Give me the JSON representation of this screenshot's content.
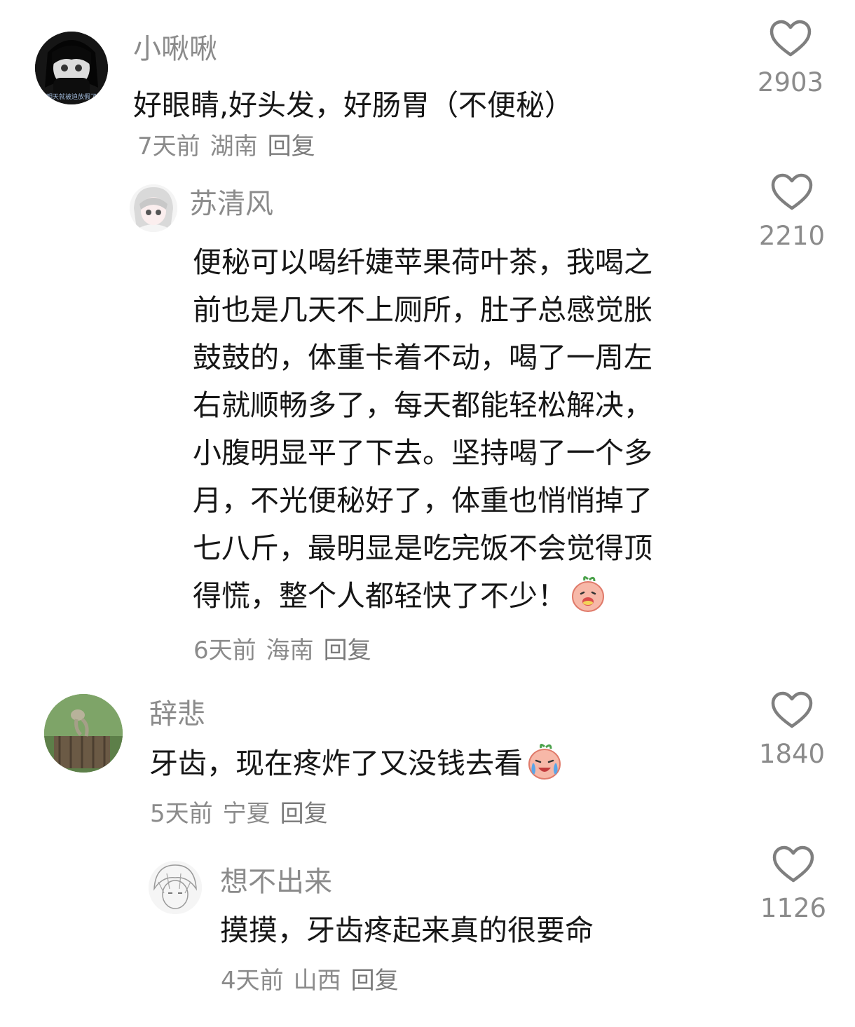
{
  "comments": [
    {
      "username": "小啾啾",
      "text": "好眼睛,好头发，好肠胃（不便秘）",
      "time": "7天前",
      "location": "湖南",
      "reply": "回复",
      "likes": "2903",
      "avatar_text": "我想明天就被迫放假了都给"
    },
    {
      "username": "苏清风",
      "text_lines": [
        "便秘可以喝纤婕苹果荷叶茶，我喝之",
        "前也是几天不上厕所，肚子总感觉胀",
        "鼓鼓的，体重卡着不动，喝了一周左",
        "右就顺畅多了，每天都能轻松解决，",
        "小腹明显平了下去。坚持喝了一个多",
        "月，不光便秘好了，体重也悄悄掉了",
        "七八斤，最明显是吃完饭不会觉得顶",
        "得慌，整个人都轻快了不少！"
      ],
      "time": "6天前",
      "location": "海南",
      "reply": "回复",
      "likes": "2210",
      "emoji": "happy-peach-emoji"
    },
    {
      "username": "辞悲",
      "text": "牙齿，现在疼炸了又没钱去看",
      "time": "5天前",
      "location": "宁夏",
      "reply": "回复",
      "likes": "1840",
      "emoji": "crying-peach-emoji"
    },
    {
      "username": "想不出来",
      "text": "摸摸，牙齿疼起来真的很要命",
      "time": "4天前",
      "location": "山西",
      "reply": "回复",
      "likes": "1126"
    }
  ],
  "colors": {
    "username": "#8b8b8b",
    "text": "#161616",
    "meta": "#8b8b8b",
    "heart": "#7f7f7f",
    "background": "#ffffff"
  }
}
